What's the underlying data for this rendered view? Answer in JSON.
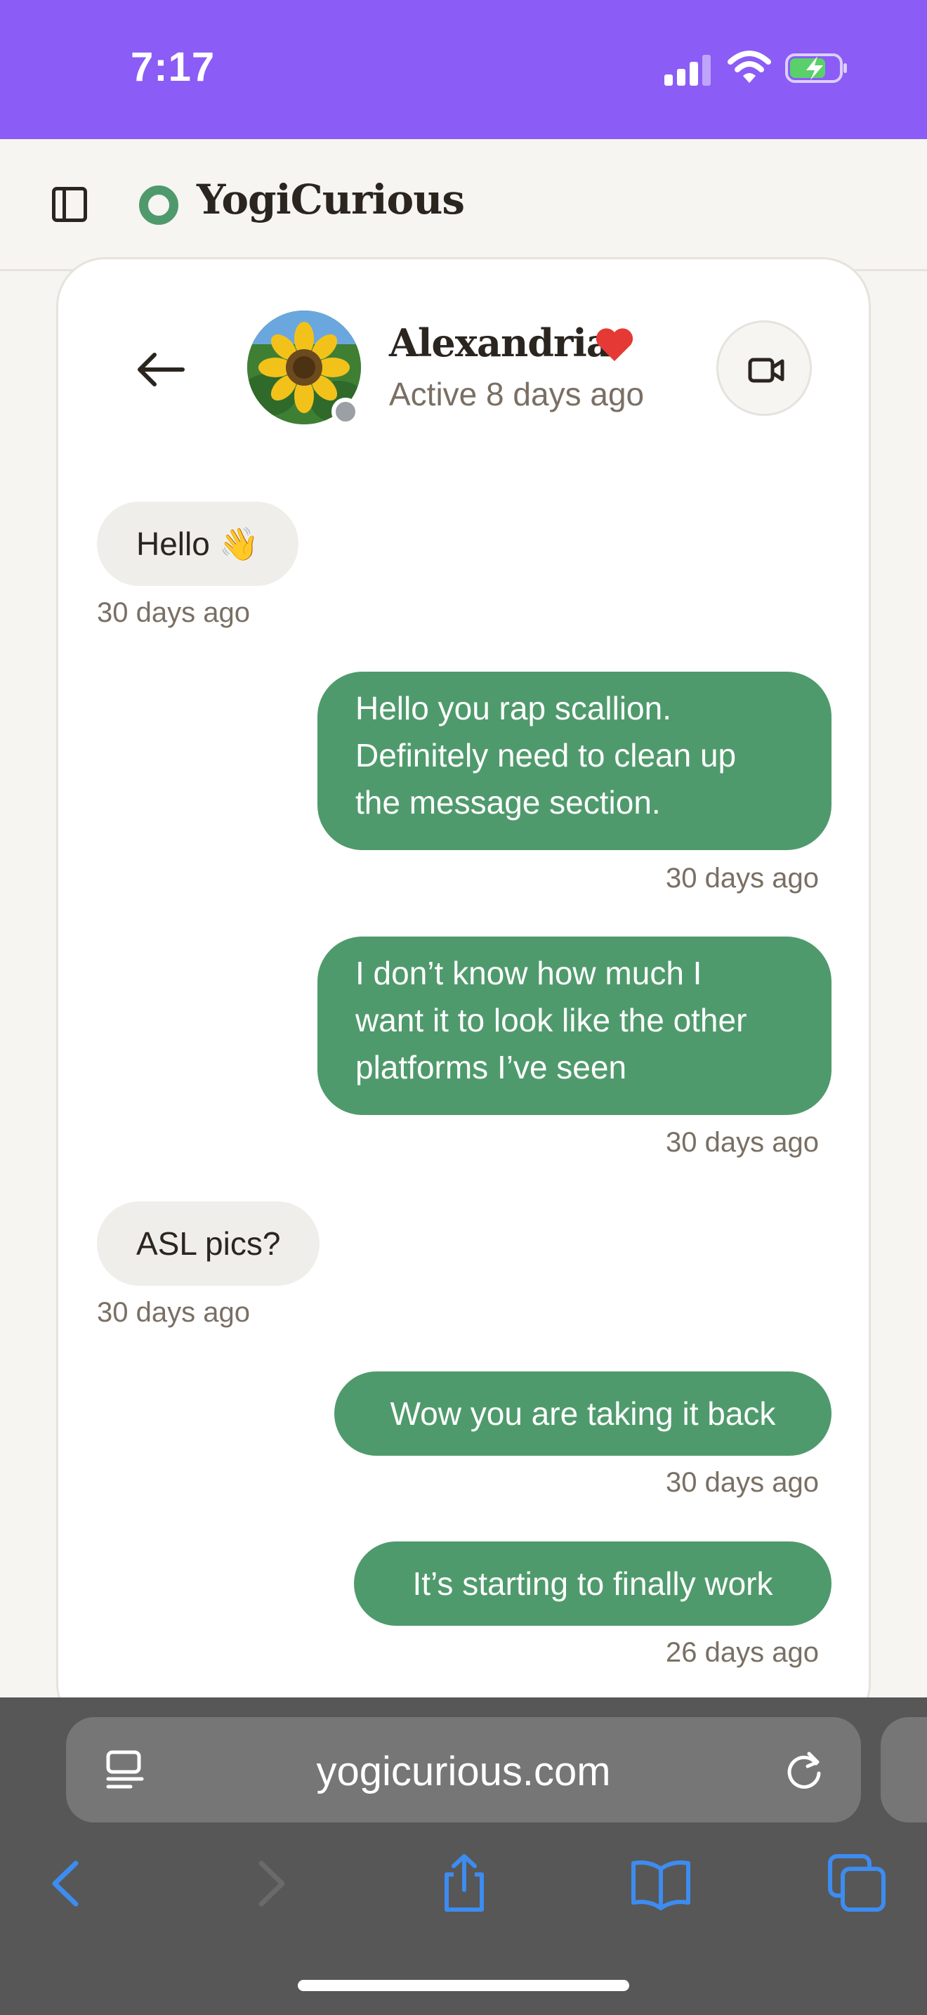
{
  "status_bar": {
    "time": "7:17",
    "icons": [
      "signal-icon",
      "wifi-icon",
      "battery-charging-icon"
    ]
  },
  "app": {
    "brand": "YogiCurious",
    "icons": [
      "sidebar-toggle-icon",
      "logo-ring-icon"
    ]
  },
  "colors": {
    "status_bar": "#8b5cf6",
    "accent_green": "#4f9a6c",
    "incoming_bubble": "#efeeea",
    "heart": "#e53935"
  },
  "chat_header": {
    "name": "Alexandria",
    "status": "Active 8 days ago",
    "icons": [
      "back-arrow-icon",
      "heart-icon",
      "video-camera-icon"
    ]
  },
  "messages": [
    {
      "direction": "incoming",
      "lines": [
        "Hello 👋"
      ],
      "time": "30 days ago"
    },
    {
      "direction": "outgoing",
      "lines": [
        "Hello you rap scallion.",
        "Definitely need to clean up",
        "the message section."
      ],
      "time": "30 days ago"
    },
    {
      "direction": "outgoing",
      "lines": [
        "I don’t know how much I",
        "want it to look like the other",
        "platforms I’ve seen"
      ],
      "time": "30 days ago"
    },
    {
      "direction": "incoming",
      "lines": [
        "ASL pics?"
      ],
      "time": "30 days ago"
    },
    {
      "direction": "outgoing",
      "lines": [
        "Wow you are taking it back"
      ],
      "time": "30 days ago"
    },
    {
      "direction": "outgoing",
      "lines": [
        "It’s starting to finally work"
      ],
      "time": "26 days ago"
    }
  ],
  "browser": {
    "url": "yogicurious.com",
    "icons": [
      "reader-icon",
      "reload-icon",
      "back-icon",
      "forward-icon",
      "share-icon",
      "bookmarks-icon",
      "tabs-icon"
    ]
  }
}
